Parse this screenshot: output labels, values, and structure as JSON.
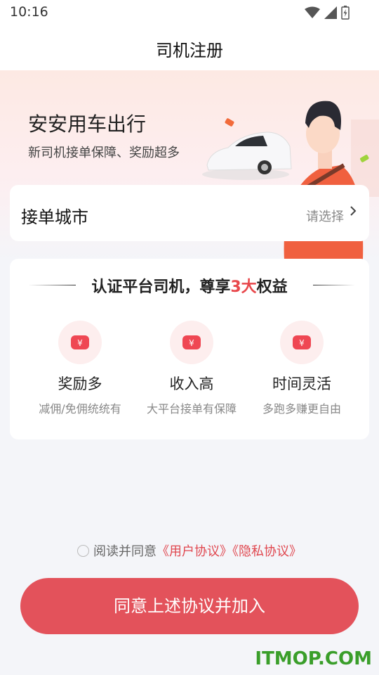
{
  "status_bar": {
    "time": "10:16"
  },
  "header": {
    "title": "司机注册"
  },
  "banner": {
    "title": "安安用车出行",
    "subtitle": "新司机接单保障、奖励超多"
  },
  "city": {
    "label": "接单城市",
    "placeholder": "请选择"
  },
  "benefits": {
    "title_prefix": "认证平台司机，尊享",
    "title_accent": "3大",
    "title_suffix": "权益",
    "items": [
      {
        "name": "奖励多",
        "desc": "减佣/免佣统统有",
        "icon": "yuan-icon"
      },
      {
        "name": "收入高",
        "desc": "大平台接单有保障",
        "icon": "yuan-icon"
      },
      {
        "name": "时间灵活",
        "desc": "多跑多赚更自由",
        "icon": "yuan-icon"
      }
    ]
  },
  "agreement": {
    "prefix": "阅读并同意",
    "user_link": "《用户协议》",
    "privacy_link": "《隐私协议》"
  },
  "join_button": {
    "label": "同意上述协议并加入"
  },
  "watermark": "ITMOP.COM",
  "colors": {
    "accent": "#e3525b",
    "link": "#e0474f"
  }
}
